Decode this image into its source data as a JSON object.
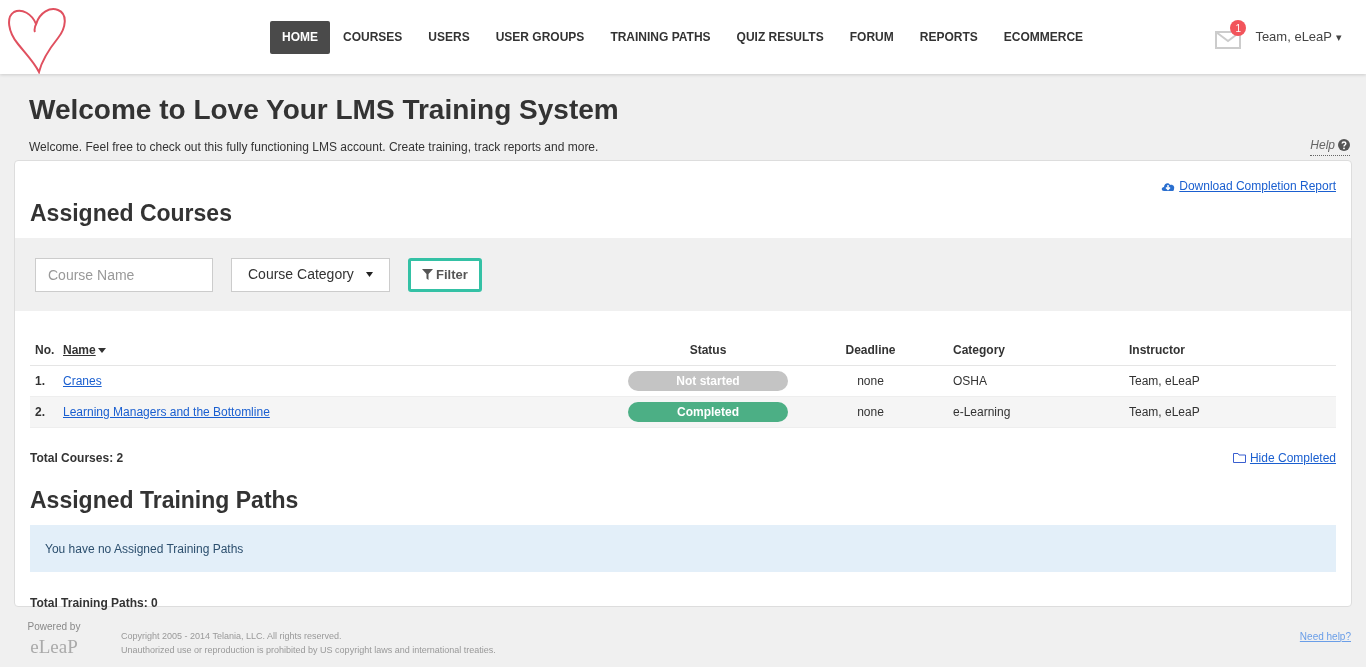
{
  "nav": {
    "items": [
      {
        "label": "HOME",
        "selected": true
      },
      {
        "label": "COURSES",
        "selected": false
      },
      {
        "label": "USERS",
        "selected": false
      },
      {
        "label": "USER GROUPS",
        "selected": false
      },
      {
        "label": "TRAINING PATHS",
        "selected": false
      },
      {
        "label": "QUIZ RESULTS",
        "selected": false
      },
      {
        "label": "FORUM",
        "selected": false
      },
      {
        "label": "REPORTS",
        "selected": false
      },
      {
        "label": "ECOMMERCE",
        "selected": false
      }
    ],
    "message_count": "1",
    "user": "Team, eLeaP",
    "user_caret": "▾"
  },
  "page": {
    "title": "Welcome to Love Your LMS Training System",
    "intro": "Welcome. Feel free to check out this fully functioning LMS account. Create training, track reports and more.",
    "help": "Help"
  },
  "courses": {
    "download_link": "Download Completion Report",
    "title": "Assigned Courses",
    "filter": {
      "name_placeholder": "Course Name",
      "category": "Course Category",
      "button": "Filter"
    },
    "columns": [
      {
        "label": "No.",
        "link": false,
        "sorted": false
      },
      {
        "label": "Name",
        "link": true,
        "sorted": true
      },
      {
        "label": "Status",
        "link": false,
        "sorted": false
      },
      {
        "label": "Deadline",
        "link": false,
        "sorted": false
      },
      {
        "label": "Category",
        "link": false,
        "sorted": false
      },
      {
        "label": "Instructor",
        "link": false,
        "sorted": false
      }
    ],
    "rows": [
      {
        "no": "1.",
        "name": "Cranes",
        "status": {
          "label": "Not started",
          "kind": "not_started"
        },
        "deadline": "none",
        "category": "OSHA",
        "instructor": "Team, eLeaP"
      },
      {
        "no": "2.",
        "name": "Learning Managers and the Bottomline",
        "status": {
          "label": "Completed",
          "kind": "completed"
        },
        "deadline": "none",
        "category": "e-Learning",
        "instructor": "Team, eLeaP"
      }
    ],
    "total": "Total Courses: 2",
    "hide_link": "Hide Completed"
  },
  "paths": {
    "title": "Assigned Training Paths",
    "notice": "You have no Assigned Training Paths",
    "total": "Total Training Paths: 0"
  },
  "footer": {
    "powered_by": "Powered by",
    "brand": "eLeaP",
    "copyright": "Copyright 2005 - 2014 Telania, LLC. All rights reserved.",
    "notice": "Unauthorized use or reproduction is prohibited by US copyright laws and international treaties.",
    "help_link": "Need help?"
  }
}
